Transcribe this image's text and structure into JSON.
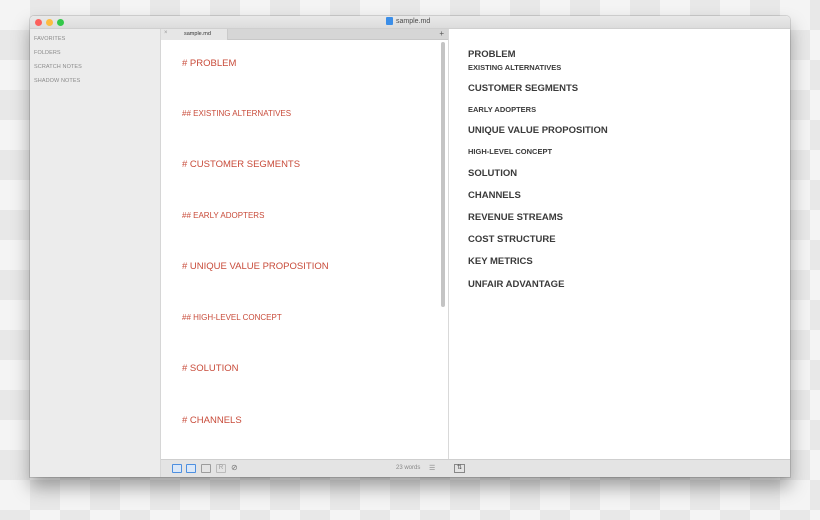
{
  "window": {
    "title": "sample.md"
  },
  "sidebar": {
    "items": [
      {
        "label": "FAVORITES"
      },
      {
        "label": "FOLDERS"
      },
      {
        "label": "SCRATCH NOTES"
      },
      {
        "label": "SHADOW NOTES"
      }
    ]
  },
  "tabs": {
    "close_glyph": "×",
    "add_glyph": "+",
    "items": [
      {
        "label": "sample.md"
      }
    ]
  },
  "editor": {
    "lines": [
      "# PROBLEM",
      "## EXISTING ALTERNATIVES",
      "# CUSTOMER SEGMENTS",
      "## EARLY ADOPTERS",
      "# UNIQUE VALUE PROPOSITION",
      "## HIGH-LEVEL CONCEPT",
      "# SOLUTION",
      "# CHANNELS"
    ]
  },
  "preview": {
    "headings": [
      "PROBLEM",
      "EXISTING ALTERNATIVES",
      "CUSTOMER SEGMENTS",
      "EARLY ADOPTERS",
      "UNIQUE VALUE PROPOSITION",
      "HIGH-LEVEL CONCEPT",
      "SOLUTION",
      "CHANNELS",
      "REVENUE STREAMS",
      "COST STRUCTURE",
      "KEY METRICS",
      "UNFAIR ADVANTAGE"
    ]
  },
  "statusbar": {
    "word_count": "23 words",
    "lines_glyph": "☰",
    "read_glyph": "R",
    "hide_glyph": "⊘",
    "swap_glyph": "⇅"
  },
  "colors": {
    "markdown_heading": "#c84b3a",
    "preview_text": "#3a3a3a",
    "accent": "#4d8fe0"
  }
}
